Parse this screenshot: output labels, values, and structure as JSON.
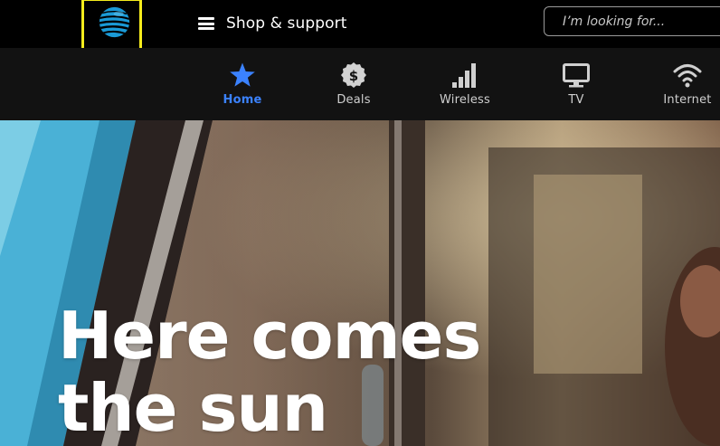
{
  "header": {
    "menu_label": "Shop & support",
    "search_placeholder": "I’m looking for..."
  },
  "nav": {
    "active_color": "#3b82ff",
    "items": [
      {
        "label": "Home",
        "icon": "star-icon",
        "active": true
      },
      {
        "label": "Deals",
        "icon": "dollar-badge-icon",
        "active": false
      },
      {
        "label": "Wireless",
        "icon": "signal-bars-icon",
        "active": false
      },
      {
        "label": "TV",
        "icon": "tv-icon",
        "active": false
      },
      {
        "label": "Internet",
        "icon": "wifi-icon",
        "active": false
      }
    ]
  },
  "hero": {
    "title_line1": "Here comes",
    "title_line2": "the sun"
  },
  "colors": {
    "focus_outline": "#f5ec1c",
    "logo_blue": "#1a9ad6"
  }
}
